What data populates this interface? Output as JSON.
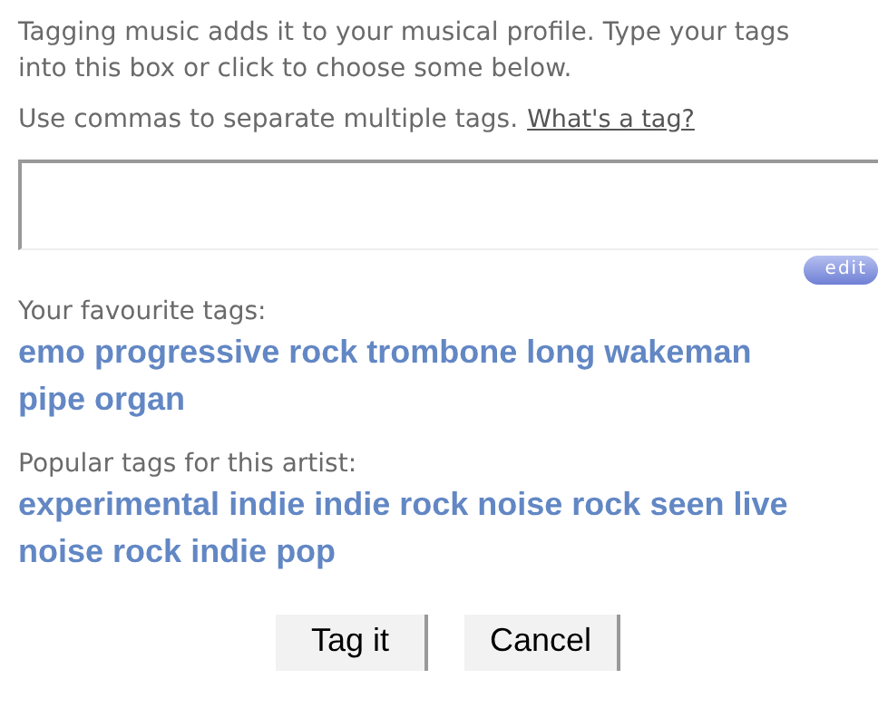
{
  "intro": "Tagging music adds it to your musical profile. Type your tags into this box or click to choose some below.",
  "hint": "Use commas to separate multiple tags.",
  "help_link": "What's a tag?",
  "edit_button": "edit",
  "favourites": {
    "label": "Your favourite tags:",
    "tags": [
      "emo",
      "progressive rock",
      "trombone",
      "long",
      "wakeman",
      "pipe organ"
    ]
  },
  "popular": {
    "label": "Popular tags for this artist:",
    "tags": [
      "experimental",
      "indie",
      "indie rock",
      "noise rock",
      "seen",
      "live",
      "noise rock",
      "indie pop"
    ]
  },
  "buttons": [
    "Tag it",
    "Cancel"
  ]
}
